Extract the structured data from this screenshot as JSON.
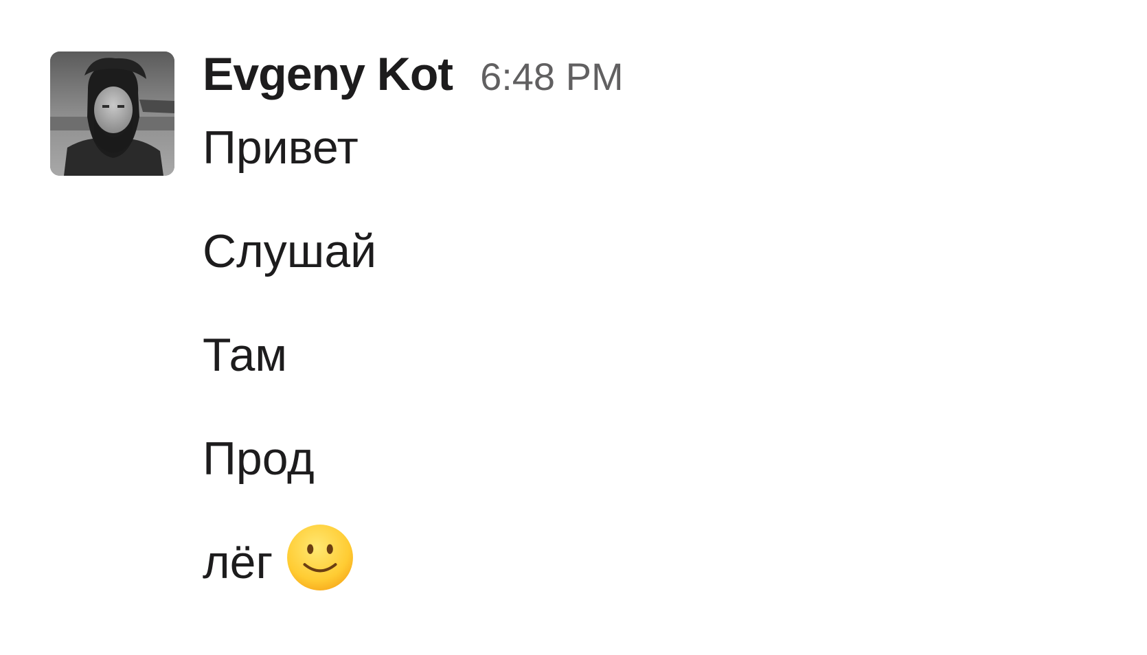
{
  "message": {
    "sender": "Evgeny Kot",
    "timestamp": "6:48 PM",
    "lines": [
      "Привет",
      "Слушай",
      "Там",
      "Прод",
      "лёг"
    ],
    "trailing_emoji": "slightly-smiling-face-icon"
  },
  "colors": {
    "sender_text": "#1d1c1d",
    "timestamp_text": "#616061",
    "background": "#ffffff"
  }
}
